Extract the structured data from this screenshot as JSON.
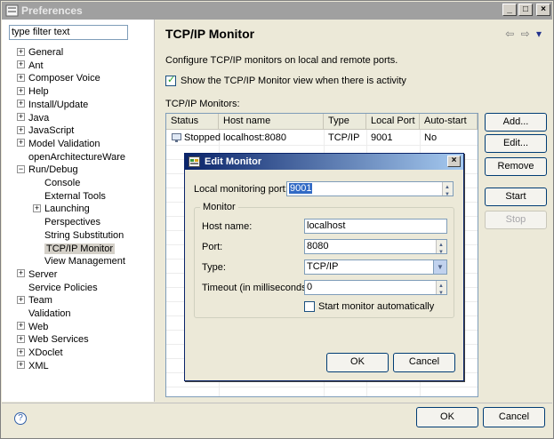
{
  "window": {
    "title": "Preferences",
    "controls": {
      "minimize": "_",
      "maximize": "□",
      "close": "×"
    }
  },
  "filter": {
    "value": "type filter text"
  },
  "tree": [
    {
      "label": "General",
      "expandable": true,
      "indent": 0
    },
    {
      "label": "Ant",
      "expandable": true,
      "indent": 0
    },
    {
      "label": "Composer Voice",
      "expandable": true,
      "indent": 0
    },
    {
      "label": "Help",
      "expandable": true,
      "indent": 0
    },
    {
      "label": "Install/Update",
      "expandable": true,
      "indent": 0
    },
    {
      "label": "Java",
      "expandable": true,
      "indent": 0
    },
    {
      "label": "JavaScript",
      "expandable": true,
      "indent": 0
    },
    {
      "label": "Model Validation",
      "expandable": true,
      "indent": 0
    },
    {
      "label": "openArchitectureWare",
      "expandable": false,
      "indent": 0
    },
    {
      "label": "Run/Debug",
      "expandable": true,
      "expanded": true,
      "indent": 0
    },
    {
      "label": "Console",
      "expandable": false,
      "indent": 1
    },
    {
      "label": "External Tools",
      "expandable": false,
      "indent": 1
    },
    {
      "label": "Launching",
      "expandable": true,
      "indent": 1
    },
    {
      "label": "Perspectives",
      "expandable": false,
      "indent": 1
    },
    {
      "label": "String Substitution",
      "expandable": false,
      "indent": 1
    },
    {
      "label": "TCP/IP Monitor",
      "expandable": false,
      "indent": 1,
      "selected": true
    },
    {
      "label": "View Management",
      "expandable": false,
      "indent": 1
    },
    {
      "label": "Server",
      "expandable": true,
      "indent": 0
    },
    {
      "label": "Service Policies",
      "expandable": false,
      "indent": 0
    },
    {
      "label": "Team",
      "expandable": true,
      "indent": 0
    },
    {
      "label": "Validation",
      "expandable": false,
      "indent": 0
    },
    {
      "label": "Web",
      "expandable": true,
      "indent": 0
    },
    {
      "label": "Web Services",
      "expandable": true,
      "indent": 0
    },
    {
      "label": "XDoclet",
      "expandable": true,
      "indent": 0
    },
    {
      "label": "XML",
      "expandable": true,
      "indent": 0
    }
  ],
  "page": {
    "title": "TCP/IP Monitor",
    "nav": {
      "back": "⇦",
      "forward": "⇨",
      "menu": "▾"
    },
    "description": "Configure TCP/IP monitors on local and remote ports.",
    "show_view_checkbox": {
      "label": "Show the TCP/IP Monitor view when there is activity",
      "checked": true
    },
    "monitors_label": "TCP/IP Monitors:",
    "table": {
      "columns": [
        "Status",
        "Host name",
        "Type",
        "Local Port",
        "Auto-start"
      ],
      "rows": [
        {
          "status": "Stopped",
          "host": "localhost:8080",
          "type": "TCP/IP",
          "port": "9001",
          "autostart": "No"
        }
      ]
    },
    "buttons": {
      "add": "Add...",
      "edit": "Edit...",
      "remove": "Remove",
      "start": "Start",
      "stop": "Stop"
    }
  },
  "footer": {
    "ok": "OK",
    "cancel": "Cancel",
    "help": "?"
  },
  "dialog": {
    "title": "Edit Monitor",
    "close": "×",
    "local_port_label": "Local monitoring port:",
    "local_port_value": "9001",
    "group_title": "Monitor",
    "host_label": "Host name:",
    "host_value": "localhost",
    "port_label": "Port:",
    "port_value": "8080",
    "type_label": "Type:",
    "type_value": "TCP/IP",
    "timeout_label": "Timeout (in milliseconds):",
    "timeout_value": "0",
    "start_auto_label": "Start monitor automatically",
    "start_auto_checked": false,
    "ok": "OK",
    "cancel": "Cancel"
  }
}
